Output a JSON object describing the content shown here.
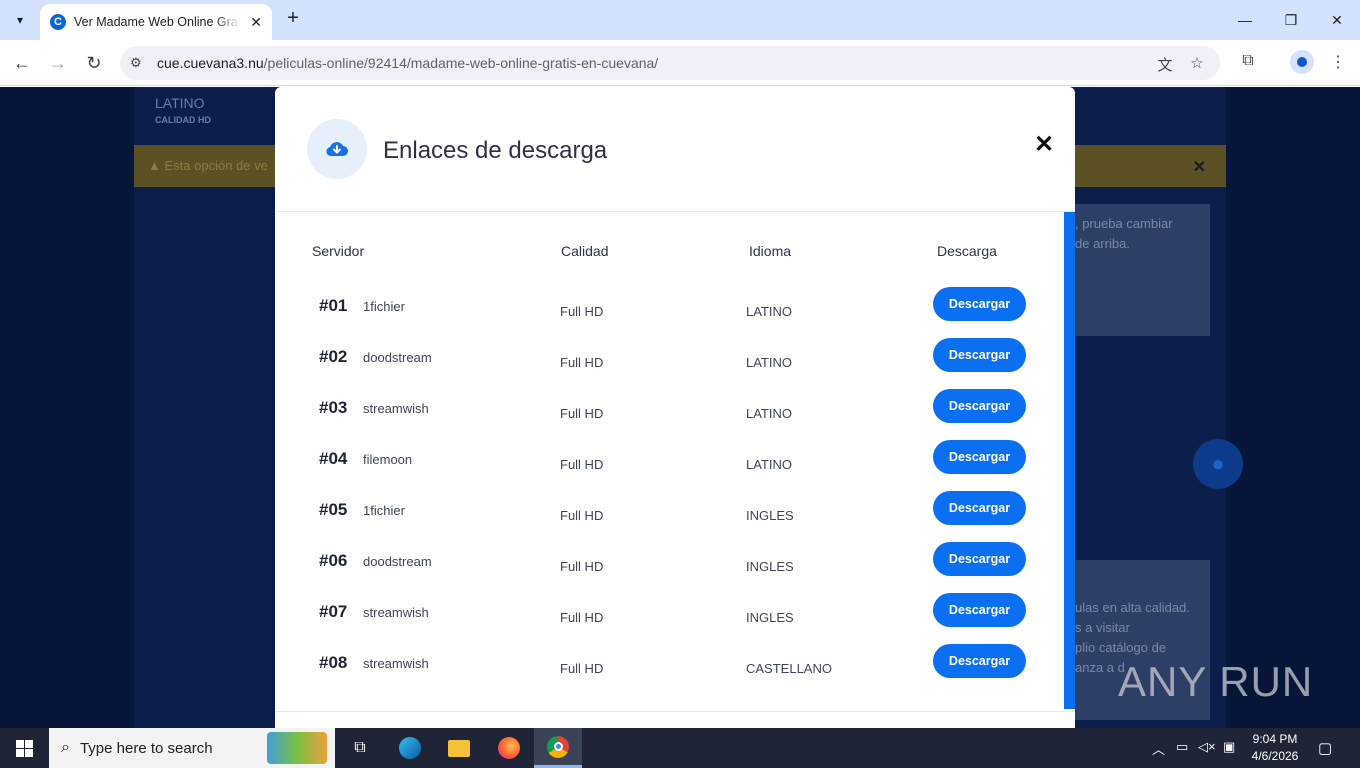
{
  "browser": {
    "tab_title": "Ver Madame Web Online Gratis en Cuevana",
    "tab_favicon_letter": "C",
    "url_host": "cue.cuevana3.nu",
    "url_path": "/peliculas-online/92414/madame-web-online-gratis-en-cuevana/"
  },
  "background_page": {
    "language": "LATINO",
    "quality": "CALIDAD HD",
    "warning": "Esta opción de ve",
    "side_box_1": ", prueba cambiar\nde arriba.",
    "side_box_2": "ulas en alta calidad.\ns a visitar\nplio catálogo de\nanza a d"
  },
  "modal": {
    "title": "Enlaces de descarga",
    "columns": {
      "server": "Servidor",
      "quality": "Calidad",
      "language": "Idioma",
      "download": "Descarga"
    },
    "rows": [
      {
        "num": "#01",
        "server": "1fichier",
        "quality": "Full HD",
        "language": "LATINO",
        "button": "Descargar"
      },
      {
        "num": "#02",
        "server": "doodstream",
        "quality": "Full HD",
        "language": "LATINO",
        "button": "Descargar"
      },
      {
        "num": "#03",
        "server": "streamwish",
        "quality": "Full HD",
        "language": "LATINO",
        "button": "Descargar"
      },
      {
        "num": "#04",
        "server": "filemoon",
        "quality": "Full HD",
        "language": "LATINO",
        "button": "Descargar"
      },
      {
        "num": "#05",
        "server": "1fichier",
        "quality": "Full HD",
        "language": "INGLES",
        "button": "Descargar"
      },
      {
        "num": "#06",
        "server": "doodstream",
        "quality": "Full HD",
        "language": "INGLES",
        "button": "Descargar"
      },
      {
        "num": "#07",
        "server": "streamwish",
        "quality": "Full HD",
        "language": "INGLES",
        "button": "Descargar"
      },
      {
        "num": "#08",
        "server": "streamwish",
        "quality": "Full HD",
        "language": "CASTELLANO",
        "button": "Descargar"
      }
    ]
  },
  "watermark": "ANY RUN",
  "taskbar": {
    "search_placeholder": "Type here to search",
    "time": "9:04 PM",
    "date": "4/6/2026"
  },
  "colors": {
    "accent": "#0a6ff0",
    "page_bg": "#071638",
    "taskbar": "#1f2536"
  }
}
